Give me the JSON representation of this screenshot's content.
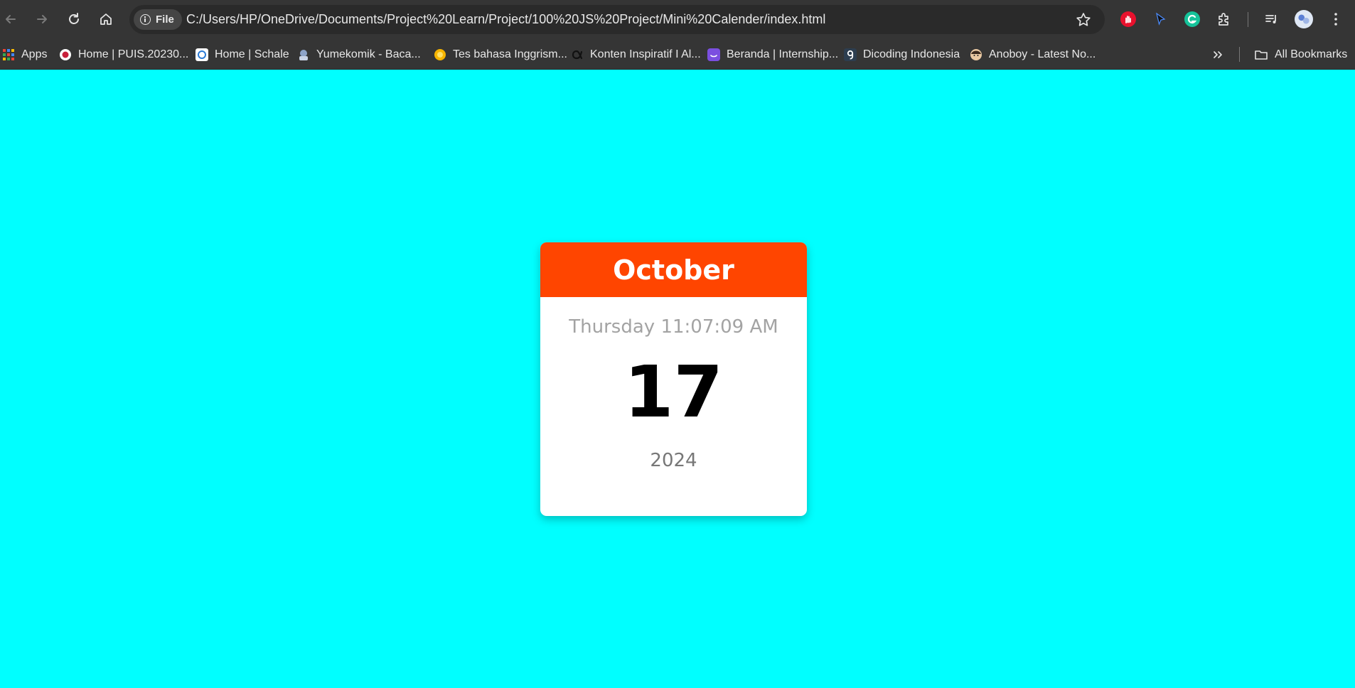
{
  "browser": {
    "address_chip": "File",
    "url": "C:/Users/HP/OneDrive/Documents/Project%20Learn/Project/100%20JS%20Project/Mini%20Calender/index.html"
  },
  "bookmarks": {
    "items": [
      {
        "label": "Apps",
        "icon": "apps-grid-icon"
      },
      {
        "label": "Home | PUIS.20230...",
        "icon": "puis-favicon"
      },
      {
        "label": "Home | Schale",
        "icon": "schale-favicon"
      },
      {
        "label": "Yumekomik - Baca...",
        "icon": "yumekomik-favicon"
      },
      {
        "label": "Tes bahasa Inggrism...",
        "icon": "tes-favicon"
      },
      {
        "label": "Konten Inspiratif I Al...",
        "icon": "alpha-favicon"
      },
      {
        "label": "Beranda | Internship...",
        "icon": "beranda-favicon"
      },
      {
        "label": "Dicoding Indonesia",
        "icon": "dicoding-favicon"
      },
      {
        "label": "Anoboy - Latest No...",
        "icon": "anoboy-favicon"
      }
    ],
    "all_bookmarks": "All Bookmarks"
  },
  "calendar": {
    "month": "October",
    "day_time": "Thursday 11:07:09 AM",
    "date": "17",
    "year": "2024"
  },
  "colors": {
    "page_background": "#00ffff",
    "month_header": "#ff4500",
    "chrome": "#353535"
  }
}
